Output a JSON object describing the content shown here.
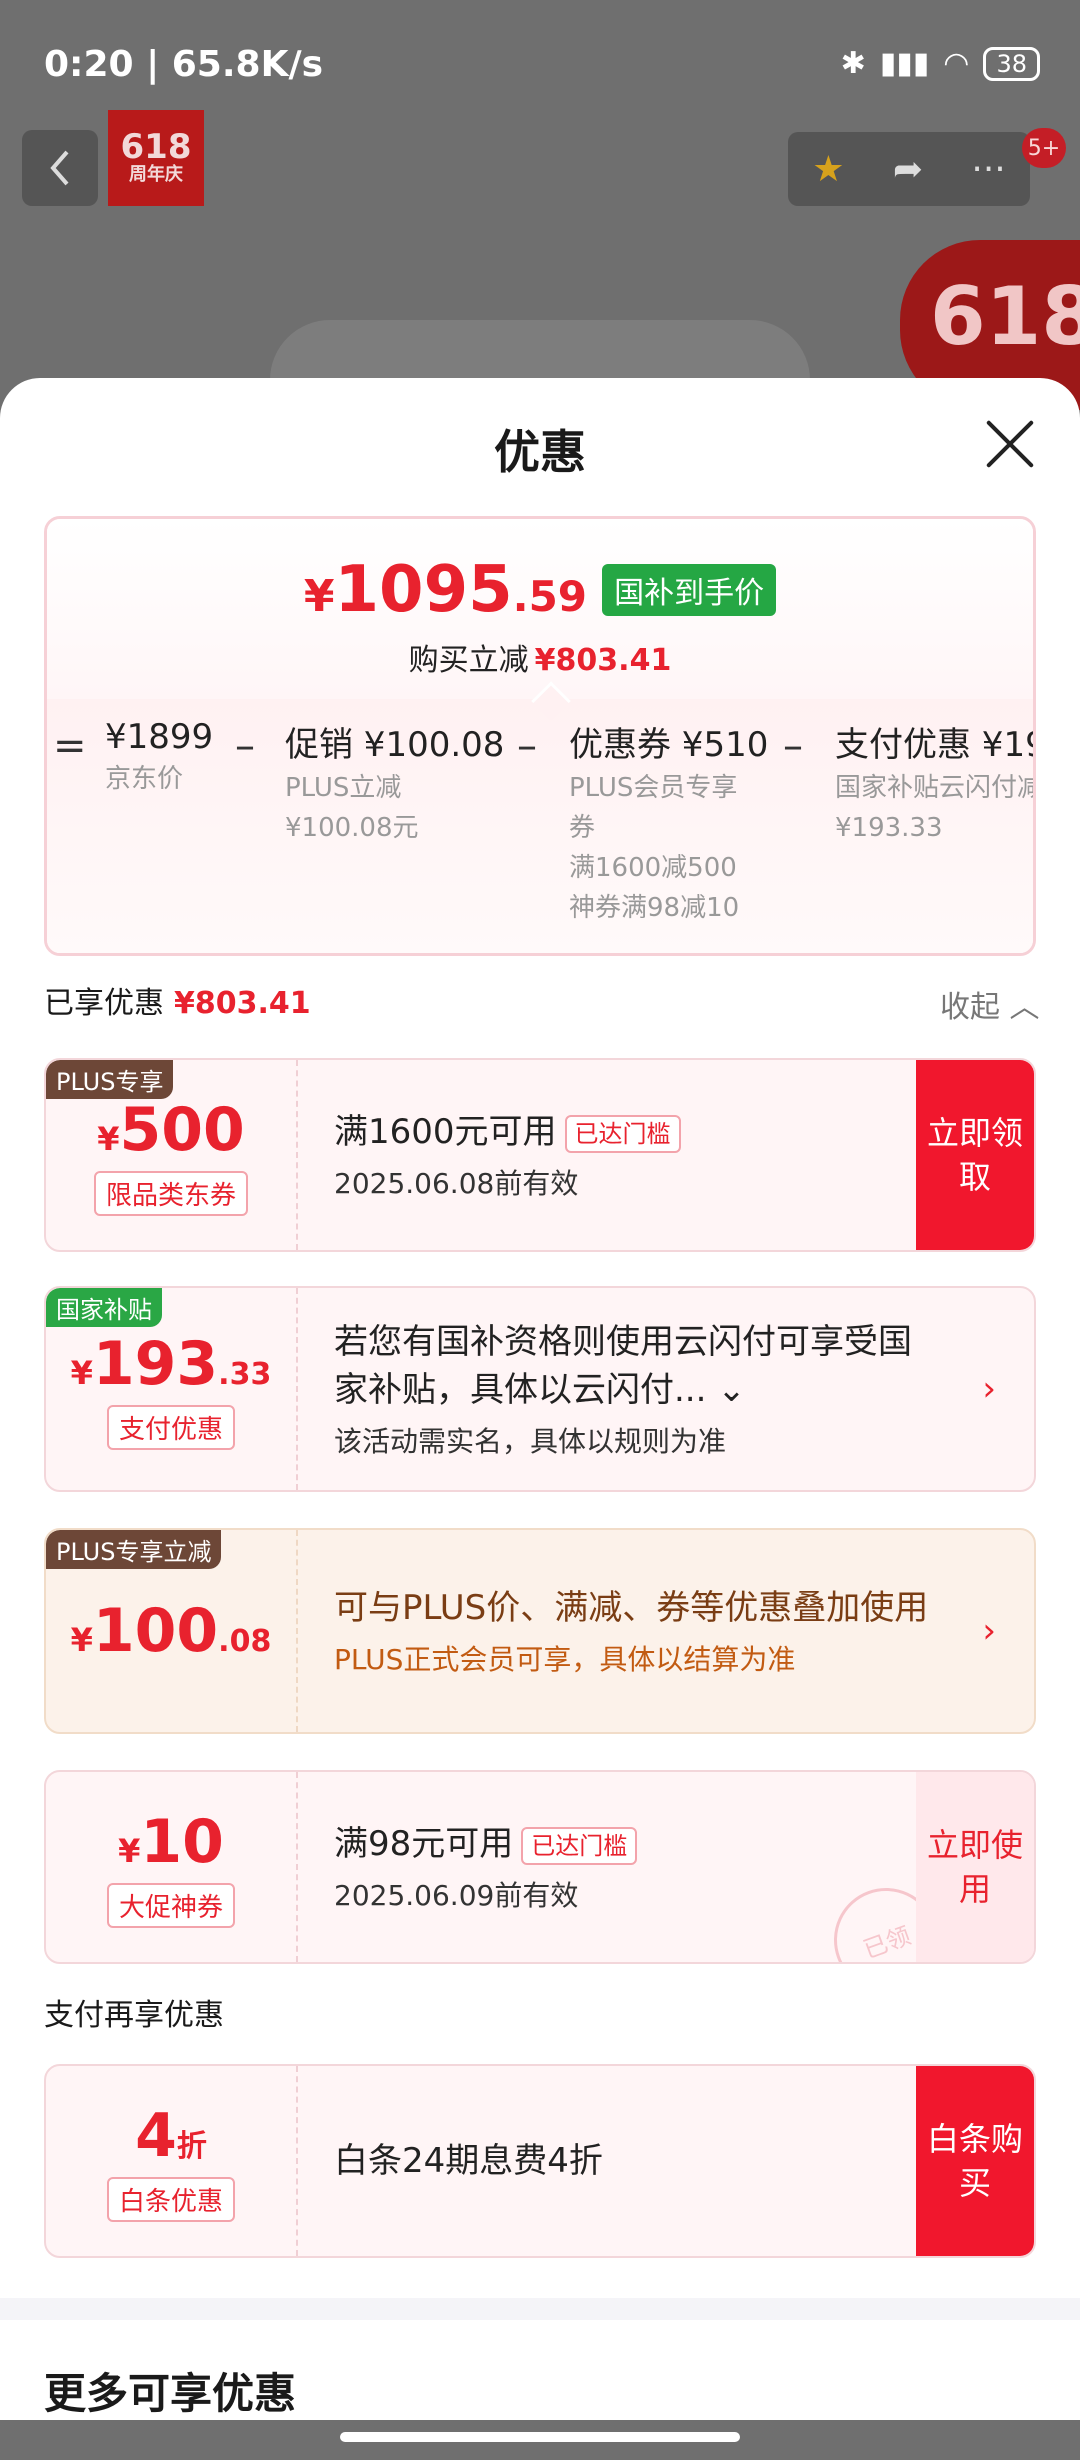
{
  "status": {
    "time": "0:20 | 65.8K/s",
    "battery": "38"
  },
  "header": {
    "brand_top": "618",
    "brand_sub": "周年庆",
    "badge": "5+",
    "promo": "618"
  },
  "sheet": {
    "title": "优惠",
    "final_price": {
      "currency": "¥",
      "integer": "1095",
      "decimal": ".59"
    },
    "final_tag": "国补到手价",
    "saved_label": "购买立减",
    "saved_value": "¥803.41",
    "calc": [
      {
        "op": "=",
        "value": "¥1899",
        "notes": [
          "京东价"
        ]
      },
      {
        "op": "–",
        "value": "促销 ¥100.08",
        "notes": [
          "PLUS立减",
          "¥100.08元"
        ]
      },
      {
        "op": "–",
        "value": "优惠券 ¥510",
        "notes": [
          "PLUS会员专享",
          "券",
          "满1600减500",
          "神券满98减10"
        ]
      },
      {
        "op": "–",
        "value": "支付优惠 ¥19",
        "notes": [
          "国家补贴云闪付减",
          "¥193.33"
        ]
      }
    ],
    "enjoyed_label": "已享优惠",
    "enjoyed_value": "¥803.41",
    "collapse_label": "收起"
  },
  "coupons": [
    {
      "corner": "PLUS专享",
      "currency": "¥",
      "amount": "500",
      "decimal": "",
      "tag": "限品类东券",
      "line1": "满1600元可用",
      "threshold": "已达门槛",
      "line2": "2025.06.08前有效",
      "button": "立即领取"
    },
    {
      "corner": "国家补贴",
      "currency": "¥",
      "amount": "193",
      "decimal": ".33",
      "tag": "支付优惠",
      "line1": "若您有国补资格则使用云闪付可享受国家补贴，具体以云闪付... ⌄",
      "line2": "该活动需实名，具体以规则为准"
    },
    {
      "corner": "PLUS专享立减",
      "currency": "¥",
      "amount": "100",
      "decimal": ".08",
      "line1": "可与PLUS价、满减、券等优惠叠加使用",
      "line2": "PLUS正式会员可享，具体以结算为准"
    },
    {
      "currency": "¥",
      "amount": "10",
      "decimal": "",
      "tag": "大促神券",
      "line1": "满98元可用",
      "threshold": "已达门槛",
      "line2": "2025.06.09前有效",
      "button": "立即使用",
      "stamp": "已领"
    }
  ],
  "pay_again_label": "支付再享优惠",
  "baitiao": {
    "amount": "4",
    "unit": "折",
    "tag": "白条优惠",
    "line1": "白条24期息费4折",
    "button": "白条购买"
  },
  "more_title": "更多可享优惠",
  "colors": {
    "accent": "#e8222e",
    "button_red": "#f1172d",
    "green_tag": "#25a744",
    "plus_brown": "#6d4737"
  }
}
